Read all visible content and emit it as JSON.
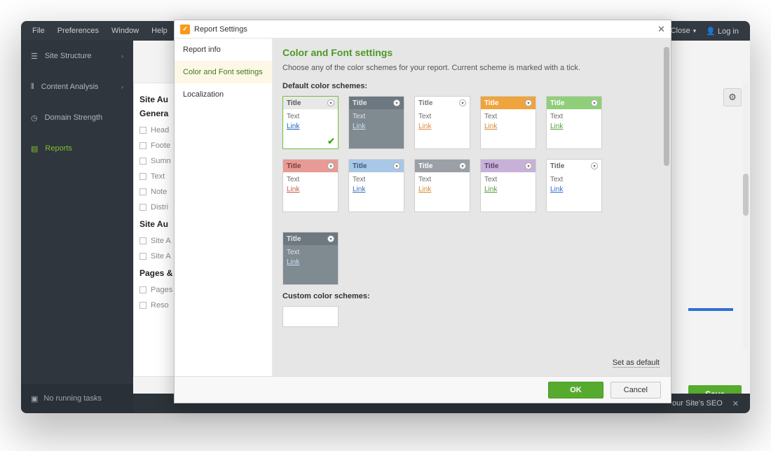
{
  "menubar": {
    "items": [
      "File",
      "Preferences",
      "Window",
      "Help"
    ],
    "close": "Close",
    "login": "Log in"
  },
  "sidebar": {
    "items": [
      {
        "label": "Site Structure",
        "expandable": true
      },
      {
        "label": "Content Analysis",
        "expandable": true
      },
      {
        "label": "Domain Strength",
        "expandable": false
      },
      {
        "label": "Reports",
        "expandable": false,
        "active": true
      }
    ],
    "tasks": "No running tasks"
  },
  "panel": {
    "heading1": "Site Au",
    "heading2": "Genera",
    "rows1": [
      "Head",
      "Foote",
      "Sumn",
      "Text",
      "Note",
      "Distri"
    ],
    "heading3": "Site Au",
    "rows2": [
      "Site A",
      "Site A"
    ],
    "heading4": "Pages &",
    "rows3": [
      "Pages",
      "Reso"
    ]
  },
  "buttons": {
    "save": "Save",
    "ok": "OK",
    "cancel": "Cancel"
  },
  "footer": {
    "seo": "our Site's SEO"
  },
  "modal": {
    "title": "Report Settings",
    "tabs": [
      "Report info",
      "Color and Font settings",
      "Localization"
    ],
    "active_tab": 1,
    "heading": "Color and Font settings",
    "description": "Choose any of the color schemes for your report. Current scheme is marked with a tick.",
    "default_label": "Default color schemes:",
    "custom_label": "Custom color schemes:",
    "set_default": "Set as default",
    "scheme_labels": {
      "title": "Title",
      "text": "Text",
      "link": "Link"
    },
    "schemes": [
      {
        "hdr_bg": "#e8e8e8",
        "hdr_color": "#555",
        "body_bg": "#ffffff",
        "link_color": "#1a5fc7",
        "selected": true
      },
      {
        "hdr_bg": "#6d7880",
        "hdr_color": "#e6e9eb",
        "body_bg": "#808a91",
        "link_color": "#c9e3f5",
        "dark": true
      },
      {
        "hdr_bg": "#ffffff",
        "hdr_color": "#777",
        "body_bg": "#ffffff",
        "link_color": "#e08b3a"
      },
      {
        "hdr_bg": "#efa43e",
        "hdr_color": "#fff",
        "body_bg": "#ffffff",
        "link_color": "#d78a2e"
      },
      {
        "hdr_bg": "#8fcf7a",
        "hdr_color": "#fff",
        "body_bg": "#ffffff",
        "link_color": "#55a038"
      },
      {
        "hdr_bg": "#e89a94",
        "hdr_color": "#7a3b38",
        "body_bg": "#ffffff",
        "link_color": "#c75a50"
      },
      {
        "hdr_bg": "#a9c7e6",
        "hdr_color": "#3a5a7a",
        "body_bg": "#ffffff",
        "link_color": "#3a6fb5"
      },
      {
        "hdr_bg": "#9aa0a5",
        "hdr_color": "#fff",
        "body_bg": "#ffffff",
        "link_color": "#d78a2e"
      },
      {
        "hdr_bg": "#c8b1d9",
        "hdr_color": "#5b3f70",
        "body_bg": "#ffffff",
        "link_color": "#55a038"
      },
      {
        "hdr_bg": "#ffffff",
        "hdr_color": "#666",
        "body_bg": "#ffffff",
        "link_color": "#2f6fd4"
      },
      {
        "hdr_bg": "#6d7880",
        "hdr_color": "#e6e9eb",
        "body_bg": "#808a91",
        "link_color": "#c9e3f5",
        "dark": true
      }
    ]
  }
}
